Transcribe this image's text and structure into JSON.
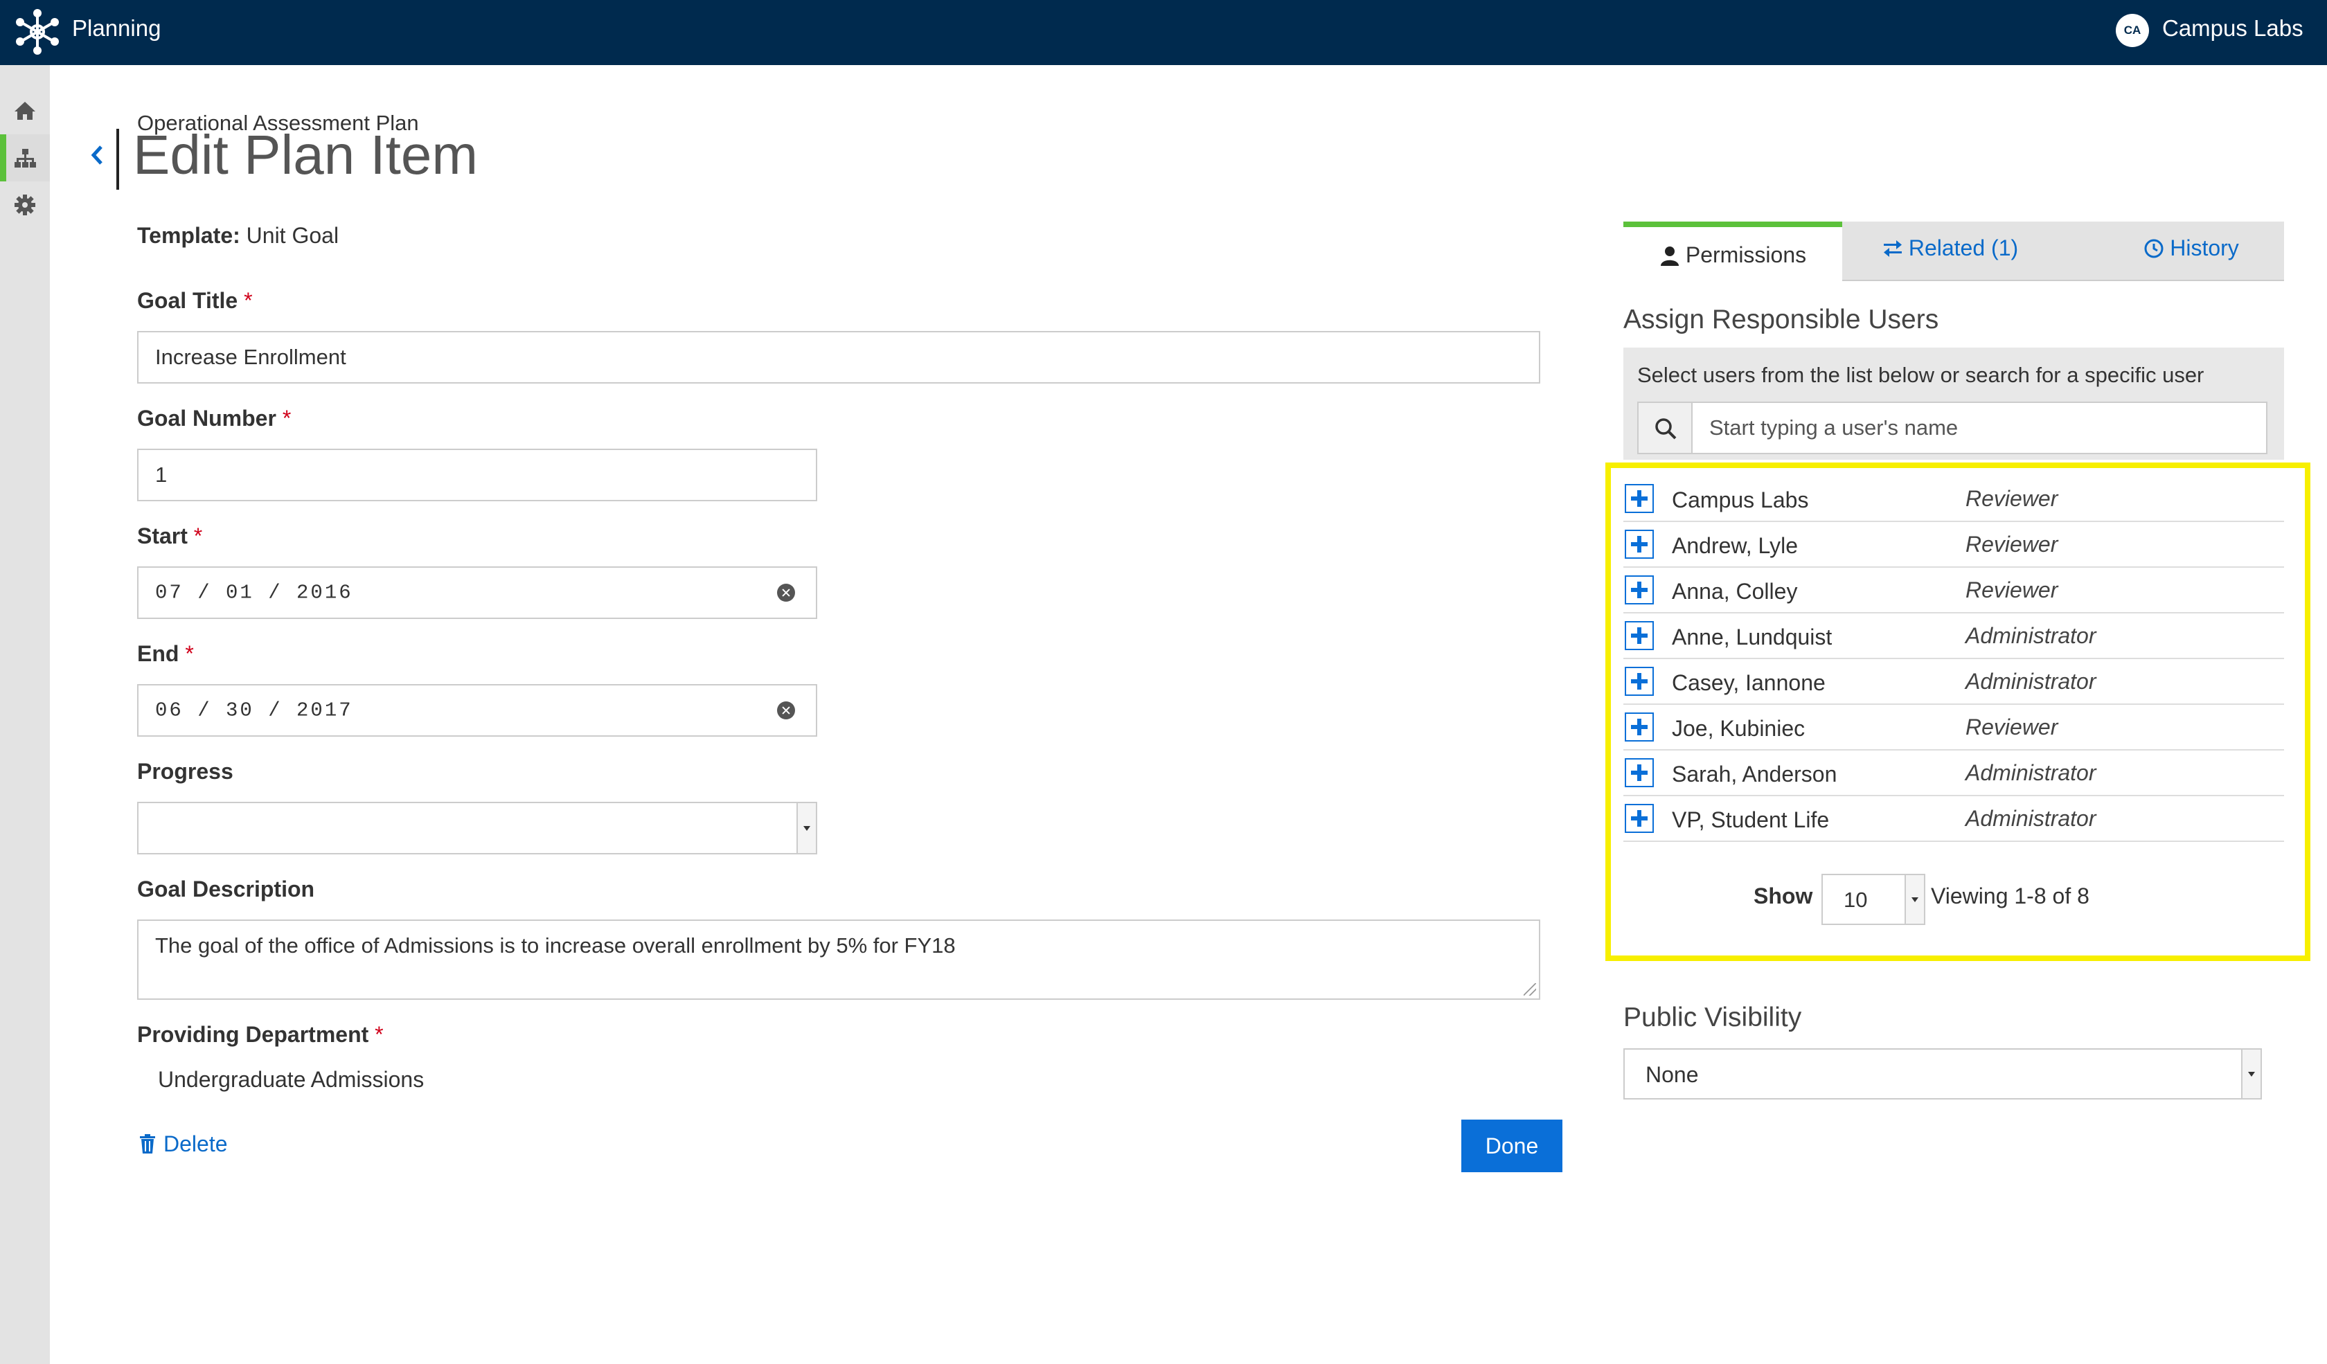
{
  "topbar": {
    "app_name": "Planning",
    "user_initials": "CA",
    "org_name": "Campus Labs"
  },
  "rail": {
    "items": [
      "home-icon",
      "sitemap-icon",
      "gear-icon"
    ],
    "active": "sitemap-icon",
    "accent_color": "#5cc13b"
  },
  "header": {
    "breadcrumb": "Operational Assessment Plan",
    "title": "Edit Plan Item"
  },
  "form": {
    "template_label": "Template:",
    "template_value": "Unit Goal",
    "required_marker": "*",
    "goal_title": {
      "label": "Goal Title",
      "value": "Increase Enrollment"
    },
    "goal_number": {
      "label": "Goal Number",
      "value": "1"
    },
    "start": {
      "label": "Start",
      "value": "07 / 01 / 2016"
    },
    "end": {
      "label": "End",
      "value": "06 / 30 / 2017"
    },
    "progress": {
      "label": "Progress",
      "value": ""
    },
    "goal_description": {
      "label": "Goal Description",
      "value": "The goal of the office of Admissions is to increase overall enrollment by 5% for FY18"
    },
    "providing_department": {
      "label": "Providing Department",
      "value": "Undergraduate Admissions"
    },
    "delete_label": "Delete",
    "done_label": "Done"
  },
  "panel": {
    "tabs": [
      {
        "label": "Permissions",
        "icon": "user-icon",
        "active": true
      },
      {
        "label": "Related (1)",
        "icon": "exchange-icon",
        "active": false
      },
      {
        "label": "History",
        "icon": "clock-icon",
        "active": false
      }
    ],
    "assign_title": "Assign Responsible Users",
    "search_hint": "Select users from the list below or search for a specific user",
    "search_placeholder": "Start typing a user's name",
    "users": [
      {
        "name": "Campus Labs",
        "role": "Reviewer"
      },
      {
        "name": "Andrew, Lyle",
        "role": "Reviewer"
      },
      {
        "name": "Anna, Colley",
        "role": "Reviewer"
      },
      {
        "name": "Anne, Lundquist",
        "role": "Administrator"
      },
      {
        "name": "Casey, Iannone",
        "role": "Administrator"
      },
      {
        "name": "Joe, Kubiniec",
        "role": "Reviewer"
      },
      {
        "name": "Sarah, Anderson",
        "role": "Administrator"
      },
      {
        "name": "VP, Student Life",
        "role": "Administrator"
      }
    ],
    "show_label": "Show",
    "page_size": "10",
    "viewing_text": "Viewing 1-8 of 8",
    "public_visibility_title": "Public Visibility",
    "public_visibility_value": "None"
  },
  "colors": {
    "topbar": "#002a4e",
    "link": "#0a6ac9",
    "primary_button": "#0a6fd8",
    "highlight": "#f7ef00",
    "required": "#d0021b"
  }
}
